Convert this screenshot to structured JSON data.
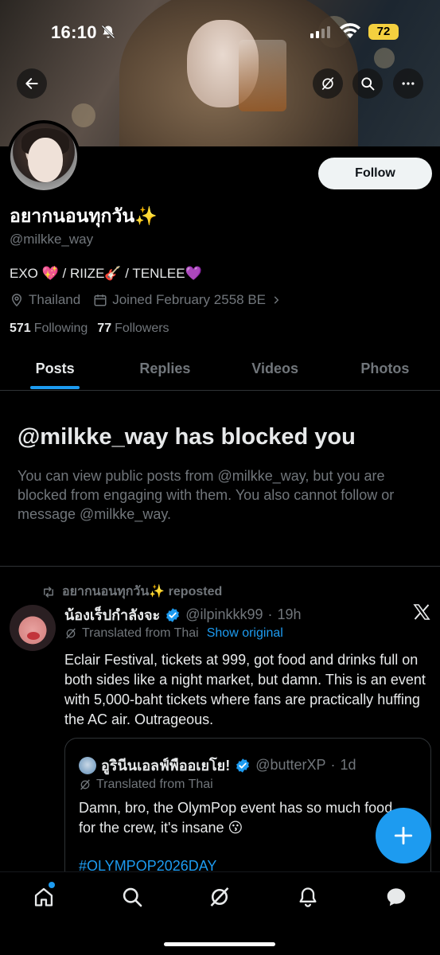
{
  "status_bar": {
    "time": "16:10",
    "battery": "72"
  },
  "profile": {
    "display_name": "อยากนอนทุกวัน✨",
    "handle": "@milkke_way",
    "bio": "EXO 💖 / RIIZE🎸 / TENLEE💜",
    "location": "Thailand",
    "joined": "Joined February 2558 BE",
    "following_count": "571",
    "following_label": "Following",
    "followers_count": "77",
    "followers_label": "Followers",
    "follow_button": "Follow"
  },
  "tabs": [
    {
      "label": "Posts",
      "active": true
    },
    {
      "label": "Replies",
      "active": false
    },
    {
      "label": "Videos",
      "active": false
    },
    {
      "label": "Photos",
      "active": false
    }
  ],
  "blocked": {
    "title": "@milkke_way has blocked you",
    "text": "You can view public posts from @milkke_way, but you are blocked from engaging with them. You also cannot follow or message @milkke_way."
  },
  "post": {
    "repost_label": "อยากนอนทุกวัน✨ reposted",
    "author_name": "น้องเร็ปกำลังจะ",
    "author_handle": "@ilpinkkk99",
    "time": "19h",
    "translated_label": "Translated from Thai",
    "show_original": "Show original",
    "body": "Eclair Festival, tickets at 999, got food and drinks full on both sides like a night market, but damn. This is an event with 5,000-baht tickets where fans are practically huffing the AC air. Outrageous.",
    "quote": {
      "author_name": "อูรินีนเอลฟ์พืออเยโย!",
      "author_handle": "@butterXP",
      "time": "1d",
      "translated_label": "Translated from Thai",
      "body": "Damn, bro, the OlymPop event has so much food for the crew, it's insane 😗",
      "hashtag": "#OLYMPOP2026DAY"
    }
  },
  "icons": {
    "back": "back-arrow-icon",
    "grok": "grok-icon",
    "search": "search-icon",
    "more": "more-icon",
    "location": "location-pin-icon",
    "calendar": "calendar-icon",
    "repost": "repost-icon",
    "verified": "verified-badge-icon",
    "x_logo": "x-logo-icon",
    "compose": "compose-plus-icon",
    "nav": [
      "home-icon",
      "search-icon",
      "grok-icon",
      "notifications-icon",
      "messages-icon"
    ]
  },
  "colors": {
    "accent": "#1d9bf0",
    "muted": "#71767b",
    "text": "#e7e9ea",
    "battery": "#f4d03f"
  }
}
